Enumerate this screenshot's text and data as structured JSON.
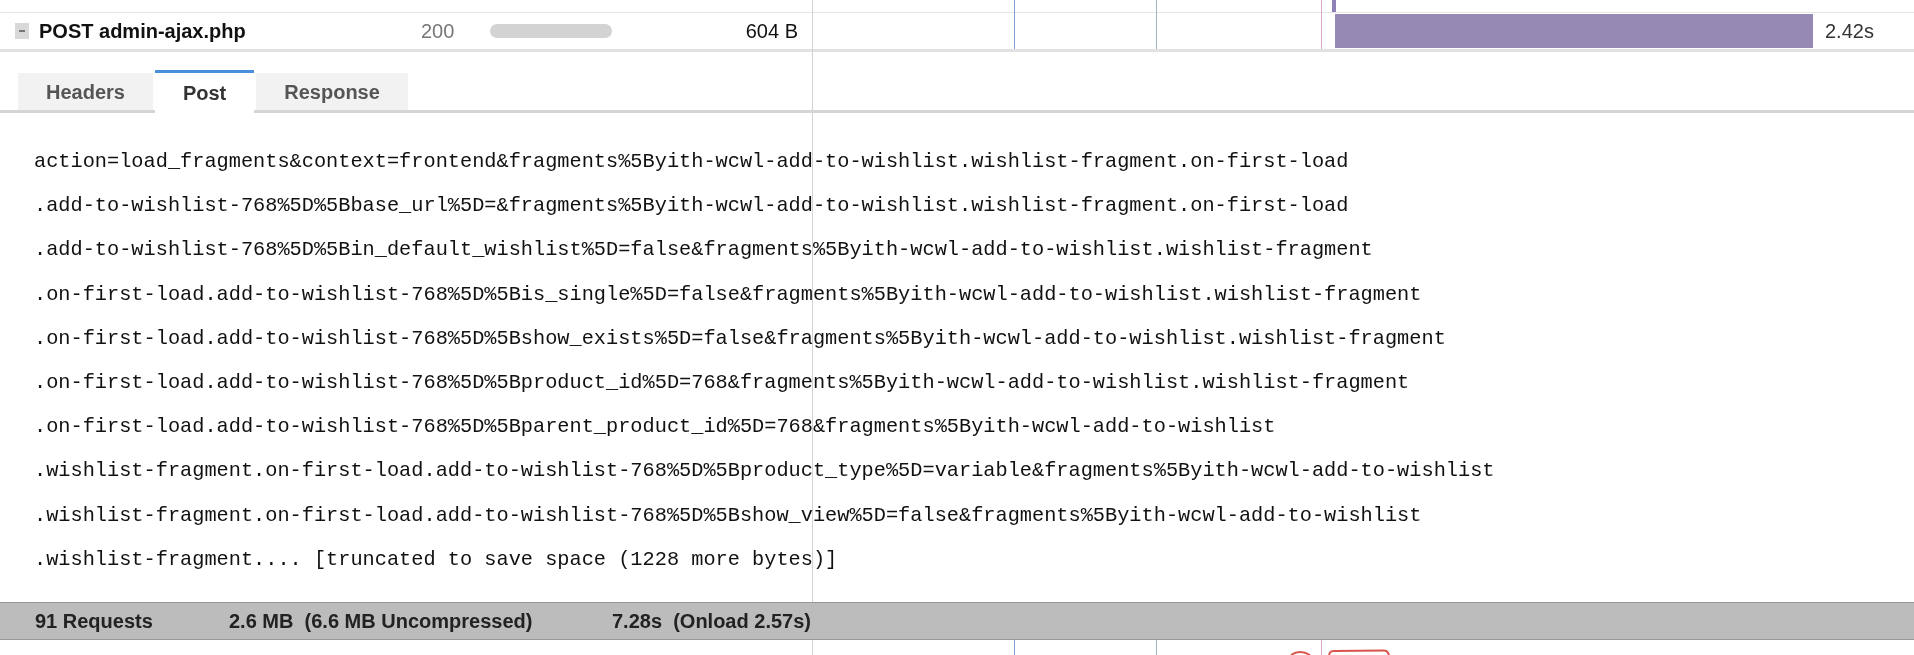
{
  "request_rows": [
    {
      "expanded": true,
      "request": "POST admin-ajax.php",
      "status": "200",
      "size": "604 B",
      "duration": "2.42s"
    }
  ],
  "detail_tabs": [
    {
      "label": "Headers",
      "selected": false
    },
    {
      "label": "Post",
      "selected": true
    },
    {
      "label": "Response",
      "selected": false
    }
  ],
  "post_data": {
    "lines": [
      "action=load_fragments&context=frontend&fragments%5Byith-wcwl-add-to-wishlist.wishlist-fragment.on-first-load",
      ".add-to-wishlist-768%5D%5Bbase_url%5D=&fragments%5Byith-wcwl-add-to-wishlist.wishlist-fragment.on-first-load",
      ".add-to-wishlist-768%5D%5Bin_default_wishlist%5D=false&fragments%5Byith-wcwl-add-to-wishlist.wishlist-fragment",
      ".on-first-load.add-to-wishlist-768%5D%5Bis_single%5D=false&fragments%5Byith-wcwl-add-to-wishlist.wishlist-fragment",
      ".on-first-load.add-to-wishlist-768%5D%5Bshow_exists%5D=false&fragments%5Byith-wcwl-add-to-wishlist.wishlist-fragment",
      ".on-first-load.add-to-wishlist-768%5D%5Bproduct_id%5D=768&fragments%5Byith-wcwl-add-to-wishlist.wishlist-fragment",
      ".on-first-load.add-to-wishlist-768%5D%5Bparent_product_id%5D=768&fragments%5Byith-wcwl-add-to-wishlist",
      ".wishlist-fragment.on-first-load.add-to-wishlist-768%5D%5Bproduct_type%5D=variable&fragments%5Byith-wcwl-add-to-wishlist",
      ".wishlist-fragment.on-first-load.add-to-wishlist-768%5D%5Bshow_view%5D=false&fragments%5Byith-wcwl-add-to-wishlist",
      ".wishlist-fragment.... [truncated to save space (1228 more bytes)]"
    ]
  },
  "status_bar": {
    "requests": "91 Requests",
    "transfer": "2.6 MB  (6.6 MB Uncompressed)",
    "load_time": "7.28s  (Onload 2.57s)"
  }
}
